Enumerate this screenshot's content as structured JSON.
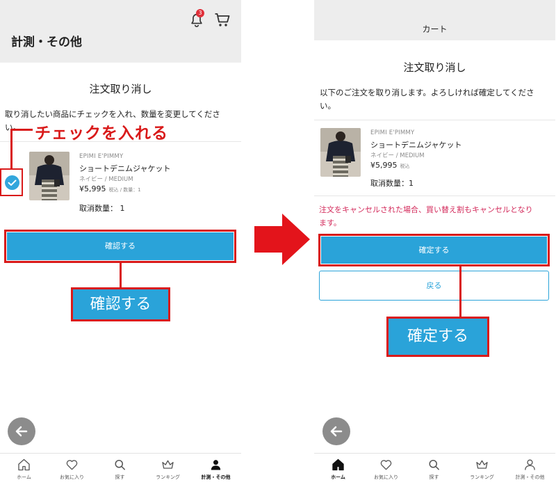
{
  "left": {
    "header_title": "計測・その他",
    "notification_count": "3",
    "section_title": "注文取り消し",
    "instruction_line1": "取り消したい商品にチェックを入れ、数量を変更してくださ",
    "instruction_line2": "い。",
    "callout": "チェックを入れる",
    "product": {
      "brand": "EPIMI E'PIMMY",
      "name": "ショートデニムジャケット",
      "variant": "ネイビー / MEDIUM",
      "price": "¥5,995",
      "price_note": "税込 / 数量：1",
      "cancel_qty": "取消数量：  1"
    },
    "confirm_button": "確認する",
    "big_label": "確認する"
  },
  "right": {
    "header_title": "カート",
    "section_title": "注文取り消し",
    "instruction_line1": "以下のご注文を取り消します。よろしければ確定してくださ",
    "instruction_line2": "い。",
    "product": {
      "brand": "EPIMI E'PIMMY",
      "name": "ショートデニムジャケット",
      "variant": "ネイビー / MEDIUM",
      "price": "¥5,995",
      "price_note": "税込",
      "cancel_qty": "取消数量：1"
    },
    "warning_line1": "注文をキャンセルされた場合、買い替え割もキャンセルとなり",
    "warning_line2": "ます。",
    "confirm_button": "確定する",
    "back_button": "戻る",
    "big_label": "確定する"
  },
  "tabs_left": [
    {
      "label": "ホーム",
      "icon": "home-icon"
    },
    {
      "label": "お気に入り",
      "icon": "heart-icon"
    },
    {
      "label": "探す",
      "icon": "search-icon"
    },
    {
      "label": "ランキング",
      "icon": "crown-icon"
    },
    {
      "label": "計測・その他",
      "icon": "person-icon"
    }
  ],
  "tabs_right": [
    {
      "label": "ホーム",
      "icon": "home-icon"
    },
    {
      "label": "お気に入り",
      "icon": "heart-icon"
    },
    {
      "label": "探す",
      "icon": "search-icon"
    },
    {
      "label": "ランキング",
      "icon": "crown-icon"
    },
    {
      "label": "計測・その他",
      "icon": "person-icon"
    }
  ],
  "colors": {
    "accent_blue": "#2aa3d9",
    "annotation_red": "#d91a1a",
    "warning_text": "#d32a5b",
    "header_gray": "#ededed"
  }
}
